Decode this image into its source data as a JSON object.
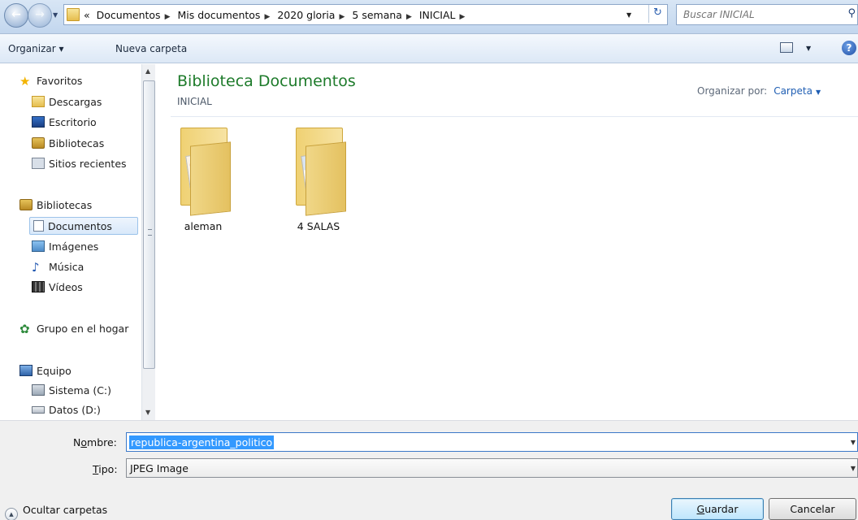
{
  "address_bar": {
    "overflow": "«",
    "crumbs": [
      "Documentos",
      "Mis documentos",
      "2020 gloria",
      "5 semana",
      "INICIAL"
    ],
    "search_placeholder": "Buscar INICIAL"
  },
  "toolbar": {
    "organize": "Organizar ▾",
    "new_folder": "Nueva carpeta"
  },
  "nav": {
    "favorites": {
      "header": "Favoritos",
      "items": [
        "Descargas",
        "Escritorio",
        "Bibliotecas",
        "Sitios recientes"
      ]
    },
    "libraries": {
      "header": "Bibliotecas",
      "items": [
        "Documentos",
        "Imágenes",
        "Música",
        "Vídeos"
      ],
      "selected": "Documentos"
    },
    "homegroup": "Grupo en el hogar",
    "computer": {
      "header": "Equipo",
      "items": [
        "Sistema (C:)",
        "Datos (D:)"
      ]
    }
  },
  "content": {
    "title": "Biblioteca Documentos",
    "subtitle": "INICIAL",
    "arrange_label": "Organizar por:",
    "arrange_value": "Carpeta",
    "items": [
      {
        "name": "aleman",
        "icon": "folder-icon"
      },
      {
        "name": "4 SALAS",
        "icon": "folder-icon"
      }
    ]
  },
  "form": {
    "name_label_pre": "N",
    "name_label_ul": "o",
    "name_label_post": "mbre:",
    "name_value": "republica-argentina_politico",
    "type_label_ul": "T",
    "type_label_post": "ipo:",
    "type_value": "JPEG Image"
  },
  "footer": {
    "hide_folders": "Ocultar carpetas",
    "save_ul": "G",
    "save_post": "uardar",
    "cancel": "Cancelar"
  },
  "colors": {
    "library_title": "#1e7b2b",
    "selection": "#3399ff",
    "link": "#1f5eb3"
  }
}
